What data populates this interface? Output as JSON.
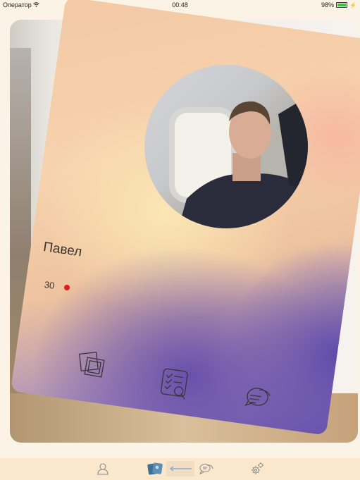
{
  "status_bar": {
    "carrier": "Оператор",
    "time": "00:48",
    "battery": "98%",
    "battery_level": 0.98
  },
  "profile": {
    "name": "Павел",
    "age": "30",
    "status_color": "#e01b1b"
  },
  "card_actions": [
    {
      "icon": "photos-icon"
    },
    {
      "icon": "questionnaire-icon"
    },
    {
      "icon": "chat-bubbles-icon"
    }
  ],
  "tab_bar": {
    "background": "#fbe8cc",
    "tabs": [
      {
        "icon": "profile-icon"
      },
      {
        "icon": "cards-icon"
      },
      {
        "icon": "back-arrow-icon"
      },
      {
        "icon": "messages-icon"
      },
      {
        "icon": "settings-icon"
      }
    ]
  }
}
